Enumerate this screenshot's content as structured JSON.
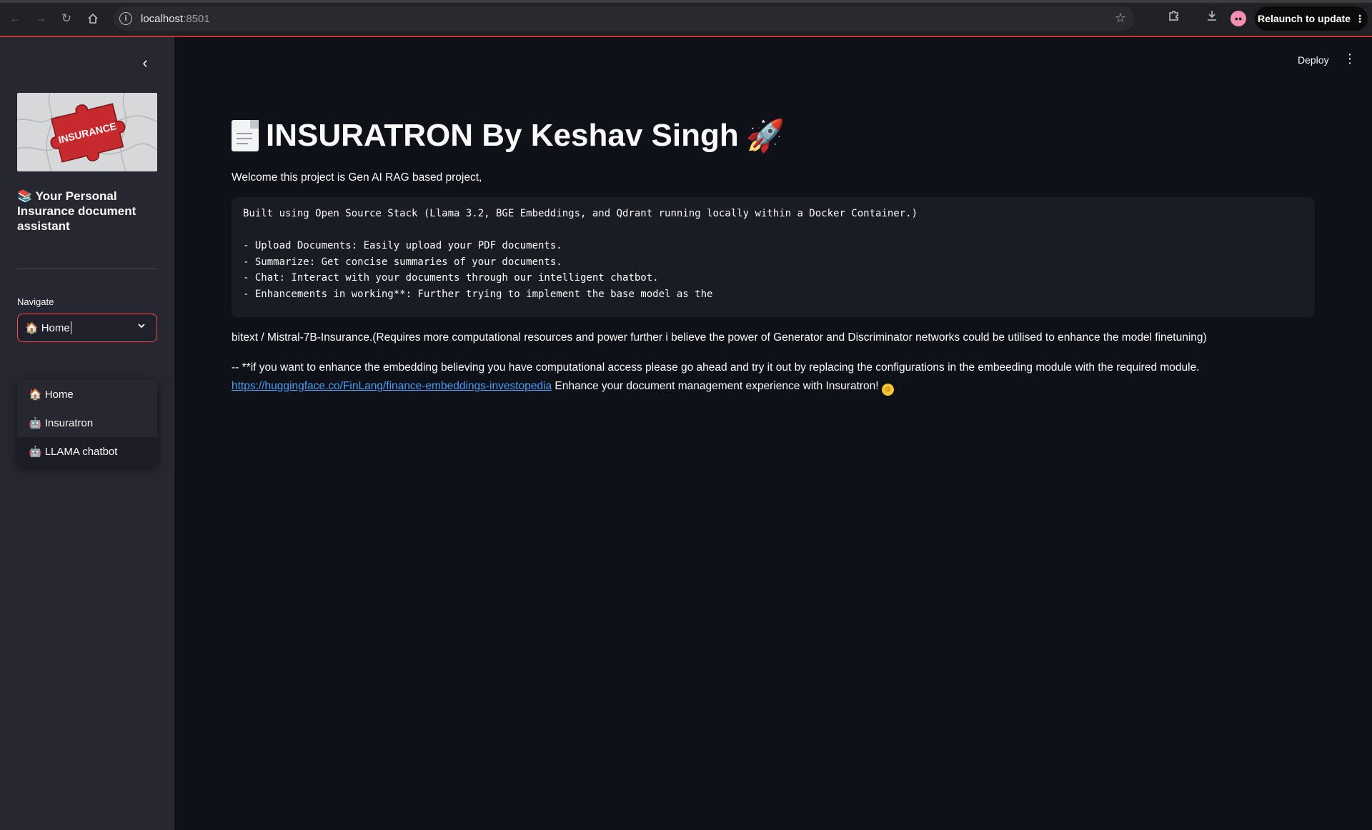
{
  "browser": {
    "url_host": "localhost",
    "url_port": ":8501",
    "relaunch_label": "Relaunch to update"
  },
  "sidebar": {
    "tagline_emoji": "📚",
    "tagline": "Your Personal Insurance document assistant",
    "logo_text": "INSURANCE",
    "navigate_label": "Navigate",
    "selected_emoji": "🏠",
    "selected_value": "Home",
    "options": [
      {
        "emoji": "🏠",
        "label": "Home"
      },
      {
        "emoji": "🤖",
        "label": "Insuratron"
      },
      {
        "emoji": "🤖",
        "label": "LLAMA chatbot"
      }
    ]
  },
  "header": {
    "deploy_label": "Deploy"
  },
  "main": {
    "title": "INSURATRON By Keshav Singh",
    "title_emoji_end": "🚀",
    "welcome": "Welcome this project is Gen AI RAG based project,",
    "code_lines": [
      "Built using Open Source Stack (Llama 3.2, BGE Embeddings, and Qdrant running locally within a Docker Container.)",
      "",
      "- Upload Documents: Easily upload your PDF documents.",
      "- Summarize: Get concise summaries of your documents.",
      "- Chat: Interact with your documents through our intelligent chatbot.",
      "- Enhancements in working**: Further trying to implement the base model as the"
    ],
    "para1": "bitext / Mistral-7B-Insurance.(Requires more computational resources and power further i believe the power of Generator and Discriminator networks could be utilised to enhance the model finetuning)",
    "para2_text": "-- **if you want to enhance the embedding believing you have computational access please go ahead and try it out by replacing the configurations in the embeeding module with the required module.",
    "para2_link": "https://huggingface.co/FinLang/finance-embeddings-investopedia",
    "para2_tail": "Enhance your document management experience with Insuratron!"
  },
  "colors": {
    "accent": "#ff4b4b",
    "link": "#4b9cf5",
    "background": "#0e1117",
    "sidebar": "#262730"
  }
}
